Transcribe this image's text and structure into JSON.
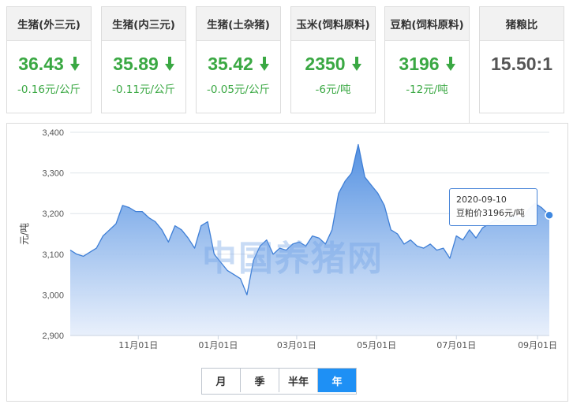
{
  "cards": [
    {
      "label": "生猪(外三元)",
      "value": "36.43",
      "change": "-0.16元/公斤",
      "trend": "down"
    },
    {
      "label": "生猪(内三元)",
      "value": "35.89",
      "change": "-0.11元/公斤",
      "trend": "down"
    },
    {
      "label": "生猪(土杂猪)",
      "value": "35.42",
      "change": "-0.05元/公斤",
      "trend": "down"
    },
    {
      "label": "玉米(饲料原料)",
      "value": "2350",
      "change": "-6元/吨",
      "trend": "down"
    },
    {
      "label": "豆粕(饲料原料)",
      "value": "3196",
      "change": "-12元/吨",
      "trend": "down",
      "active": true
    },
    {
      "label": "猪粮比",
      "value": "15.50:1",
      "change": "",
      "trend": "none"
    }
  ],
  "watermark": "中国养猪网",
  "tooltip": {
    "date": "2020-09-10",
    "text": "豆粕价3196元/吨"
  },
  "range_buttons": [
    {
      "label": "月",
      "active": false
    },
    {
      "label": "季",
      "active": false
    },
    {
      "label": "半年",
      "active": false
    },
    {
      "label": "年",
      "active": true
    }
  ],
  "colors": {
    "down": "#3aa843",
    "line": "#3f7fd6",
    "fill_top": "#4a8be0",
    "fill_bottom": "#e6eefb",
    "active_button": "#1e90f5"
  },
  "chart_data": {
    "type": "area",
    "ylabel": "元/吨",
    "ylim": [
      2900,
      3400
    ],
    "yticks": [
      2900,
      3000,
      3100,
      3200,
      3300,
      3400
    ],
    "ytick_labels": [
      "2,900",
      "3,000",
      "3,100",
      "3,200",
      "3,300",
      "3,400"
    ],
    "xlim": [
      "2019-09-10",
      "2020-09-10"
    ],
    "xticks": [
      "2019-11-01",
      "2020-01-01",
      "2020-03-01",
      "2020-05-01",
      "2020-07-01",
      "2020-09-01"
    ],
    "xtick_labels": [
      "11月01日",
      "01月01日",
      "03月01日",
      "05月01日",
      "07月01日",
      "09月01日"
    ],
    "grid": true,
    "legend": "none",
    "series": [
      {
        "x": [
          "2019-09-10",
          "2019-09-15",
          "2019-09-20",
          "2019-09-25",
          "2019-09-30",
          "2019-10-05",
          "2019-10-10",
          "2019-10-15",
          "2019-10-20",
          "2019-10-25",
          "2019-10-30",
          "2019-11-04",
          "2019-11-09",
          "2019-11-14",
          "2019-11-19",
          "2019-11-24",
          "2019-11-29",
          "2019-12-04",
          "2019-12-09",
          "2019-12-14",
          "2019-12-19",
          "2019-12-24",
          "2019-12-29",
          "2020-01-03",
          "2020-01-08",
          "2020-01-13",
          "2020-01-18",
          "2020-01-23",
          "2020-01-28",
          "2020-02-02",
          "2020-02-07",
          "2020-02-12",
          "2020-02-17",
          "2020-02-22",
          "2020-02-27",
          "2020-03-03",
          "2020-03-08",
          "2020-03-13",
          "2020-03-18",
          "2020-03-23",
          "2020-03-28",
          "2020-04-02",
          "2020-04-07",
          "2020-04-12",
          "2020-04-17",
          "2020-04-22",
          "2020-04-27",
          "2020-05-02",
          "2020-05-07",
          "2020-05-12",
          "2020-05-17",
          "2020-05-22",
          "2020-05-27",
          "2020-06-01",
          "2020-06-06",
          "2020-06-11",
          "2020-06-16",
          "2020-06-21",
          "2020-06-26",
          "2020-07-01",
          "2020-07-06",
          "2020-07-11",
          "2020-07-16",
          "2020-07-21",
          "2020-07-26",
          "2020-07-31",
          "2020-08-05",
          "2020-08-10",
          "2020-08-15",
          "2020-08-20",
          "2020-08-25",
          "2020-08-30",
          "2020-09-04",
          "2020-09-10"
        ],
        "y": [
          3110,
          3100,
          3095,
          3105,
          3115,
          3145,
          3160,
          3175,
          3220,
          3215,
          3205,
          3205,
          3190,
          3180,
          3160,
          3130,
          3170,
          3160,
          3140,
          3115,
          3170,
          3180,
          3100,
          3080,
          3060,
          3050,
          3040,
          3000,
          3085,
          3120,
          3135,
          3100,
          3115,
          3110,
          3125,
          3130,
          3120,
          3145,
          3140,
          3125,
          3160,
          3250,
          3280,
          3300,
          3370,
          3290,
          3270,
          3250,
          3220,
          3160,
          3150,
          3125,
          3135,
          3120,
          3115,
          3125,
          3110,
          3115,
          3090,
          3145,
          3135,
          3160,
          3140,
          3165,
          3175,
          3185,
          3180,
          3190,
          3195,
          3185,
          3210,
          3225,
          3215,
          3196
        ]
      }
    ]
  }
}
